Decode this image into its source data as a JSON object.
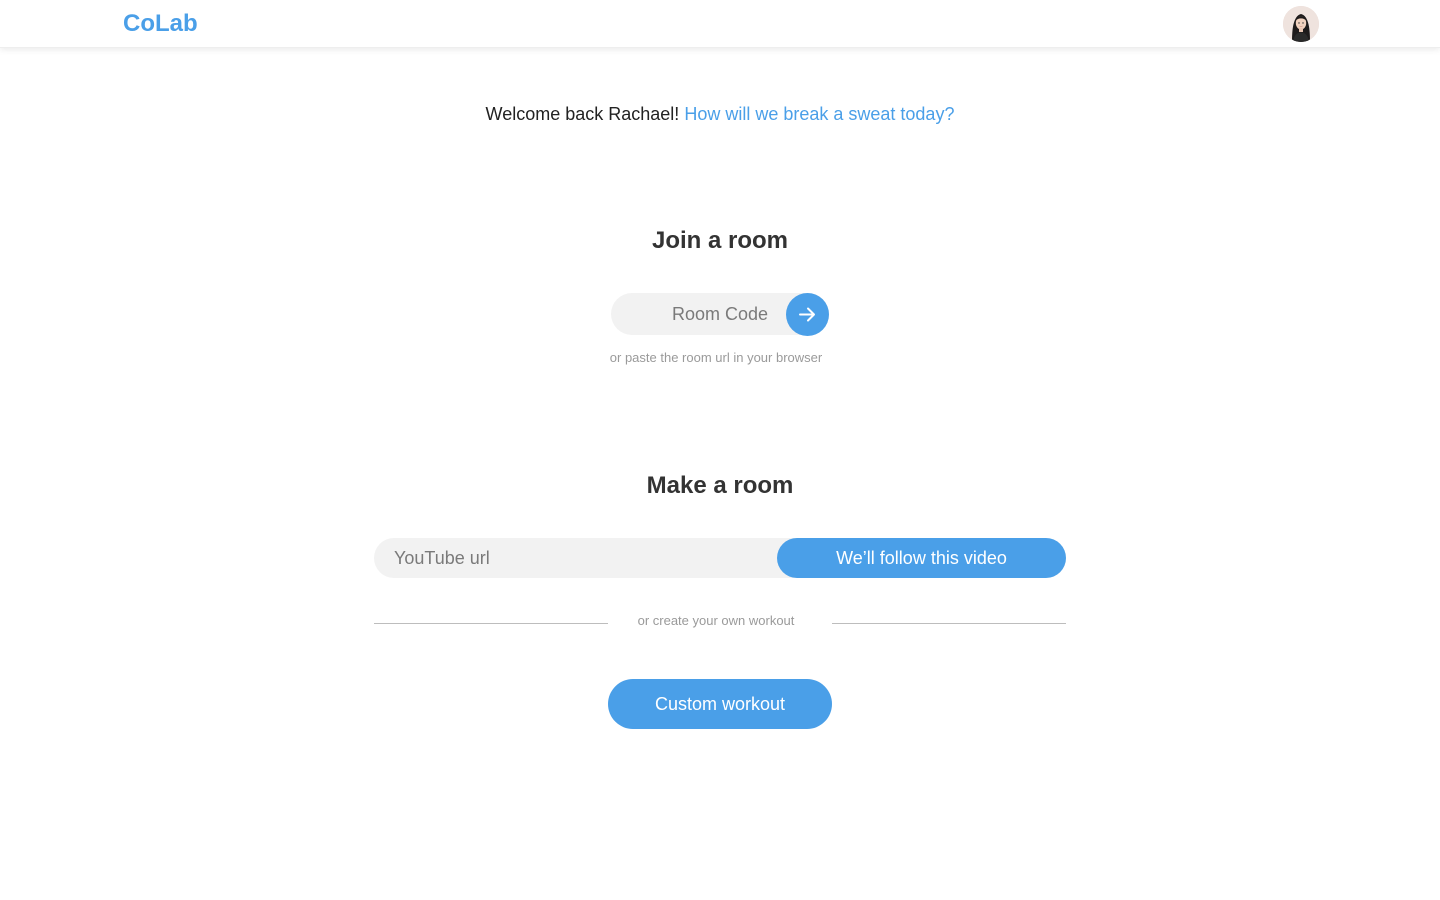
{
  "header": {
    "logo": "CoLab",
    "avatar_alt": "user avatar"
  },
  "welcome": {
    "greeting": "Welcome back Rachael!",
    "prompt": "How will we break a sweat today?"
  },
  "join": {
    "title": "Join a room",
    "room_code_placeholder": "Room Code",
    "room_code_value": "",
    "submit_icon": "arrow-right-icon",
    "hint": "or paste the room url in your browser"
  },
  "make": {
    "title": "Make a room",
    "youtube_placeholder": "YouTube url",
    "youtube_value": "",
    "follow_label": "We’ll follow this video",
    "divider_text": "or create your own workout",
    "custom_label": "Custom workout"
  },
  "colors": {
    "accent": "#4a9fe8",
    "input_bg": "#f2f2f2",
    "muted_text": "#9a9a9a"
  }
}
